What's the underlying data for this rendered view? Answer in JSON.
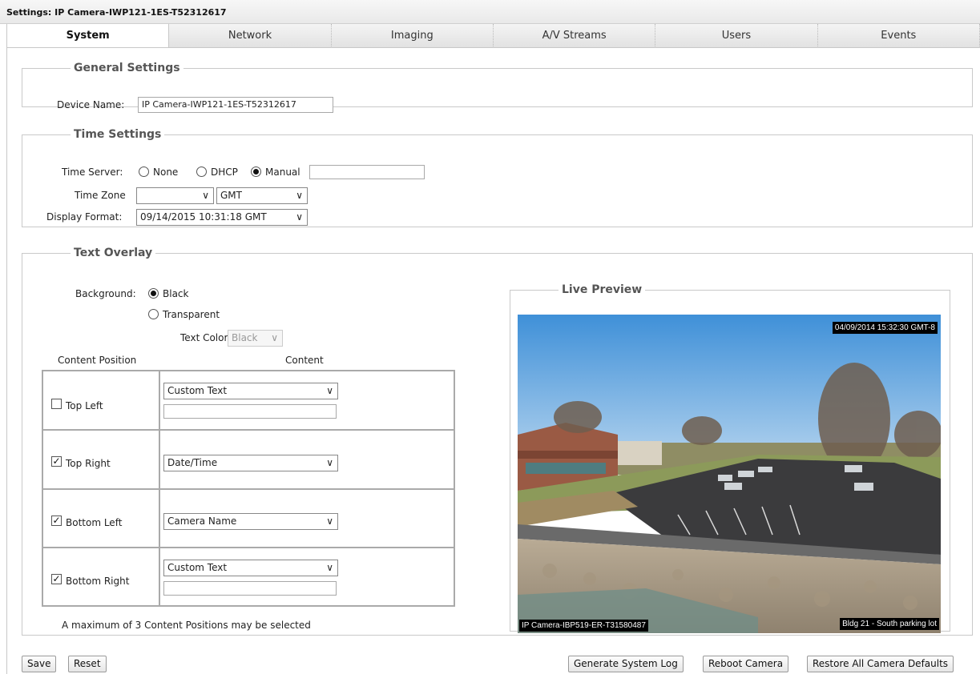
{
  "window": {
    "title": "Settings: IP Camera-IWP121-1ES-T52312617"
  },
  "tabs": [
    {
      "label": "System",
      "active": true
    },
    {
      "label": "Network",
      "active": false
    },
    {
      "label": "Imaging",
      "active": false
    },
    {
      "label": "A/V Streams",
      "active": false
    },
    {
      "label": "Users",
      "active": false
    },
    {
      "label": "Events",
      "active": false
    }
  ],
  "general": {
    "legend": "General Settings",
    "device_name_label": "Device Name:",
    "device_name_value": "IP Camera-IWP121-1ES-T52312617"
  },
  "time": {
    "legend": "Time Settings",
    "server_label": "Time Server:",
    "server_options": [
      "None",
      "DHCP",
      "Manual"
    ],
    "server_selected": "Manual",
    "manual_value": "",
    "zone_label": "Time Zone",
    "zone_value": "",
    "zone_offset_value": "GMT",
    "format_label": "Display Format:",
    "format_value": "09/14/2015 10:31:18 GMT"
  },
  "overlay": {
    "legend": "Text Overlay",
    "background_label": "Background:",
    "background_options": [
      "Black",
      "Transparent"
    ],
    "background_selected": "Black",
    "text_color_label": "Text Color",
    "text_color_value": "Black",
    "col_position": "Content Position",
    "col_content": "Content",
    "rows": [
      {
        "position": "Top Left",
        "checked": false,
        "content": "Custom Text",
        "custom_text": ""
      },
      {
        "position": "Top Right",
        "checked": true,
        "content": "Date/Time"
      },
      {
        "position": "Bottom Left",
        "checked": true,
        "content": "Camera Name"
      },
      {
        "position": "Bottom Right",
        "checked": true,
        "content": "Custom Text",
        "custom_text": ""
      }
    ],
    "note": "A maximum of 3 Content Positions may be selected"
  },
  "preview": {
    "legend": "Live Preview",
    "datetime": "04/09/2014 15:32:30 GMT-8",
    "camera_name": "IP Camera-IBP519-ER-T31580487",
    "custom_text": "Bldg 21 - South parking lot"
  },
  "footer": {
    "save": "Save",
    "reset": "Reset",
    "gen_log": "Generate System Log",
    "reboot": "Reboot Camera",
    "restore": "Restore All Camera Defaults"
  },
  "icons": {
    "dropdown": "chevron-down-icon",
    "checkmark": "check-icon"
  },
  "colors": {
    "tab_active_bg": "#ffffff",
    "tab_bg": "#e9e9e9",
    "border": "#c9c9c9"
  }
}
